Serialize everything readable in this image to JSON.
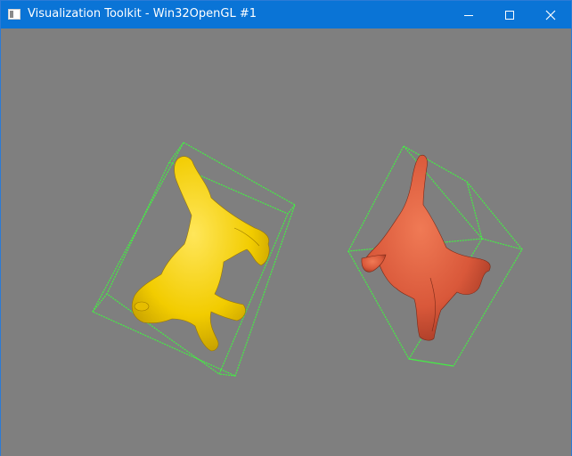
{
  "window": {
    "title": "Visualization Toolkit - Win32OpenGL #1",
    "controls": {
      "minimize": "minimize",
      "maximize": "maximize",
      "close": "close"
    }
  },
  "colors": {
    "titlebar": "#0a74d6",
    "background": "#7f7f7f",
    "bounding_box": "#44ee44",
    "cat_left": "#f2cc00",
    "cat_right": "#d9583a"
  },
  "scene": {
    "objects": [
      {
        "name": "yellow-cat",
        "color": "#f2cc00"
      },
      {
        "name": "red-cat",
        "color": "#d9583a"
      }
    ]
  }
}
